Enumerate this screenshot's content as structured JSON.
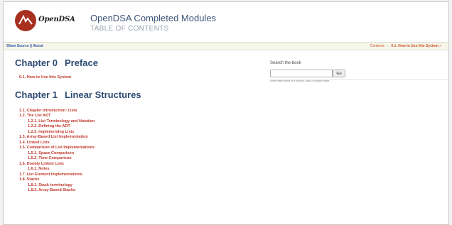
{
  "brand": {
    "logo_text": "OpenDSA"
  },
  "header": {
    "title": "OpenDSA Completed Modules",
    "subtitle": "TABLE OF CONTENTS"
  },
  "navbar": {
    "show_source": "Show Source",
    "separator": "||",
    "about": "About",
    "contents": "Contents",
    "crumb_sep": "::",
    "current": "0.1. How to Use this System",
    "next_arrow": "»"
  },
  "chapters": [
    {
      "number": "Chapter 0",
      "title": "Preface",
      "items": [
        {
          "label": "0.1. How to Use this System",
          "level": 1
        }
      ]
    },
    {
      "number": "Chapter 1",
      "title": "Linear Structures",
      "items": [
        {
          "label": "1.1. Chapter Introduction: Lists",
          "level": 1
        },
        {
          "label": "1.2. The List ADT",
          "level": 1
        },
        {
          "label": "1.2.1. List Terminology and Notation",
          "level": 2
        },
        {
          "label": "1.2.2. Defining the ADT",
          "level": 2
        },
        {
          "label": "1.2.3. Implementing Lists",
          "level": 2
        },
        {
          "label": "1.3. Array-Based List Implementation",
          "level": 1
        },
        {
          "label": "1.4. Linked Lists",
          "level": 1
        },
        {
          "label": "1.5. Comparison of List Implementations",
          "level": 1
        },
        {
          "label": "1.5.1. Space Comparison",
          "level": 2
        },
        {
          "label": "1.5.2. Time Comparison",
          "level": 2
        },
        {
          "label": "1.6. Doubly Linked Lists",
          "level": 1
        },
        {
          "label": "1.6.1. Notes",
          "level": 2
        },
        {
          "label": "1.7. List Element Implementations",
          "level": 1
        },
        {
          "label": "1.8. Stacks",
          "level": 1
        },
        {
          "label": "1.8.1. Stack terminology",
          "level": 2
        },
        {
          "label": "1.8.2. Array-Based Stacks",
          "level": 2
        }
      ]
    }
  ],
  "sidebar": {
    "search_title": "Search the book",
    "search_value": "",
    "go_label": "Go",
    "hint": "Enter search terms or a module, class or function name."
  },
  "colors": {
    "link": "#c0392b",
    "heading": "#2d4b73",
    "logo": "#a8301e"
  }
}
